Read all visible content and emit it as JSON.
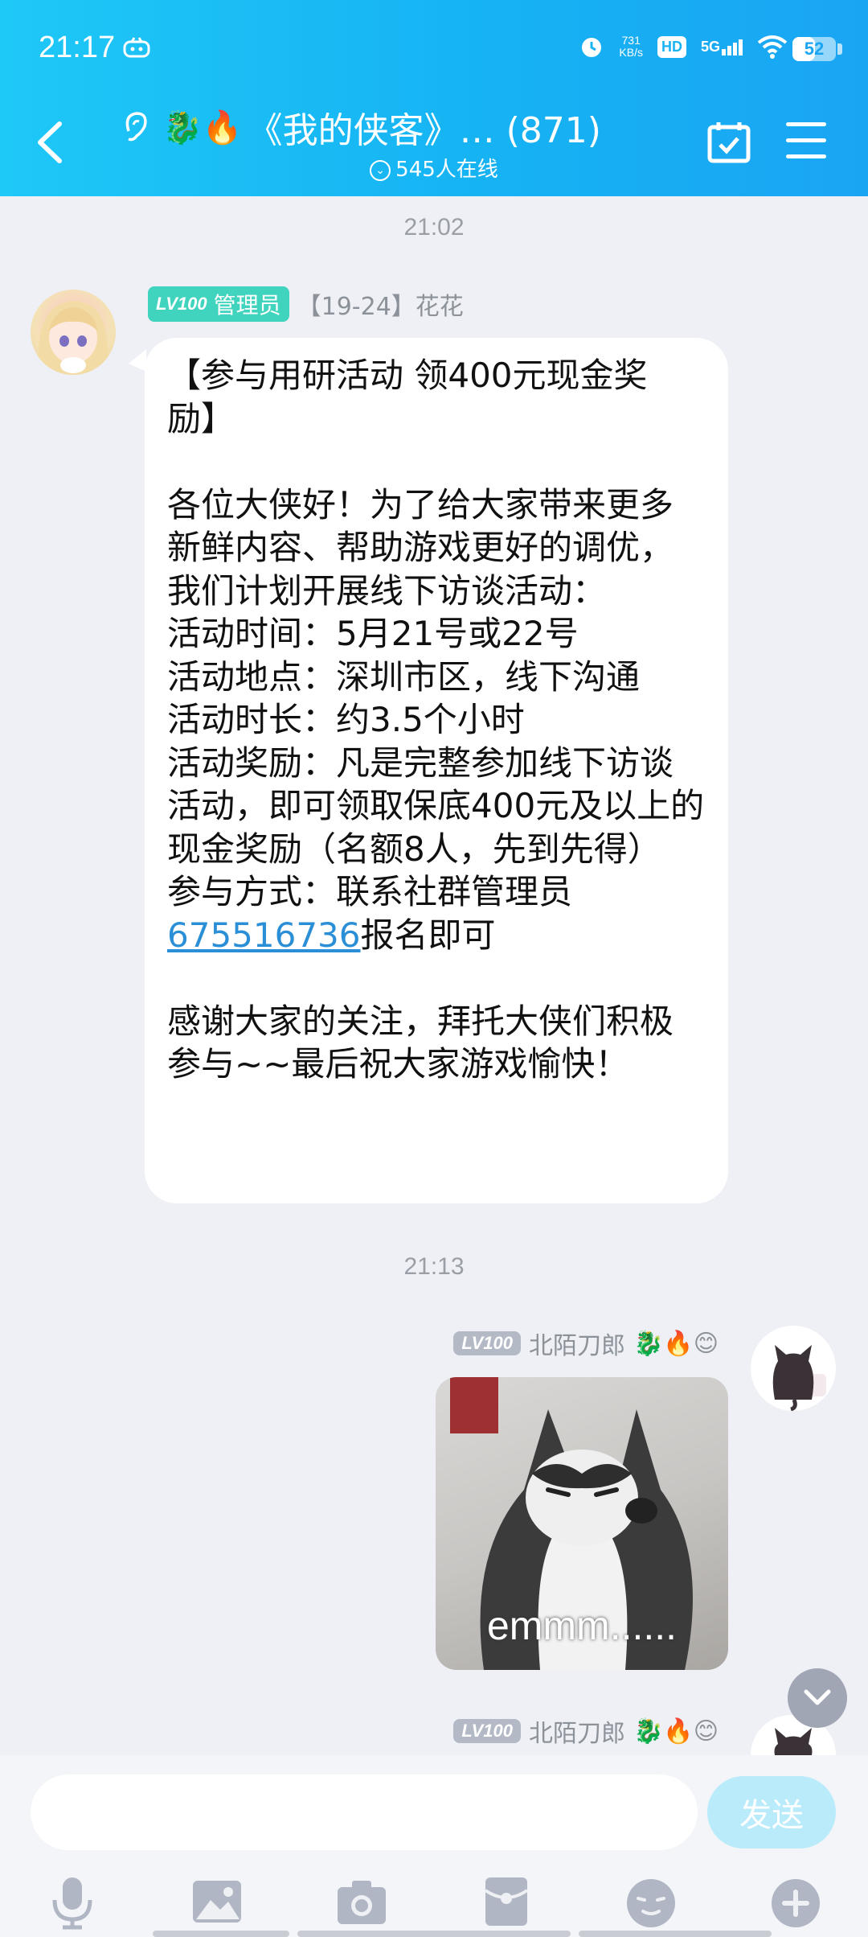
{
  "status_bar": {
    "time": "21:17",
    "net_speed_value": "731",
    "net_speed_unit": "KB/s",
    "hd_label": "HD",
    "network_label": "5G",
    "battery": "52"
  },
  "header": {
    "title_emojis": "🐉🔥",
    "title": "《我的侠客》… (871)",
    "online": "545人在线"
  },
  "messages": [
    {
      "timestamp": "21:02",
      "level": "LV100",
      "role": "管理员",
      "sender": "【19-24】花花",
      "text_before_link": "【参与用研活动 领400元现金奖励】\n\n各位大侠好！为了给大家带来更多新鲜内容、帮助游戏更好的调优，我们计划开展线下访谈活动：\n活动时间：5月21号或22号\n活动地点：深圳市区，线下沟通\n活动时长：约3.5个小时\n活动奖励：凡是完整参加线下访谈活动，即可领取保底400元及以上的现金奖励（名额8人，先到先得）\n参与方式：联系社群管理员",
      "link": "675516736",
      "text_after_link": "报名即可\n\n感谢大家的关注，拜托大侠们积极参与~~最后祝大家游戏愉快！"
    },
    {
      "timestamp": "21:13",
      "level": "LV100",
      "sender": "北陌刀郎",
      "sender_emojis": "🐉🔥😊",
      "image_caption": "emmm......"
    },
    {
      "level": "LV100",
      "sender": "北陌刀郎",
      "sender_emojis": "🐉🔥😊"
    }
  ],
  "input": {
    "placeholder": "",
    "send_label": "发送"
  },
  "toolbar": [
    "microphone-icon",
    "image-icon",
    "camera-icon",
    "red-packet-icon",
    "emoji-icon",
    "plus-icon"
  ],
  "colors": {
    "header_start": "#1ec8f7",
    "header_end": "#1aa5f3",
    "admin_badge": "#40d3bd",
    "link": "#2a8fd6",
    "send_button": "#b9ebfb"
  }
}
